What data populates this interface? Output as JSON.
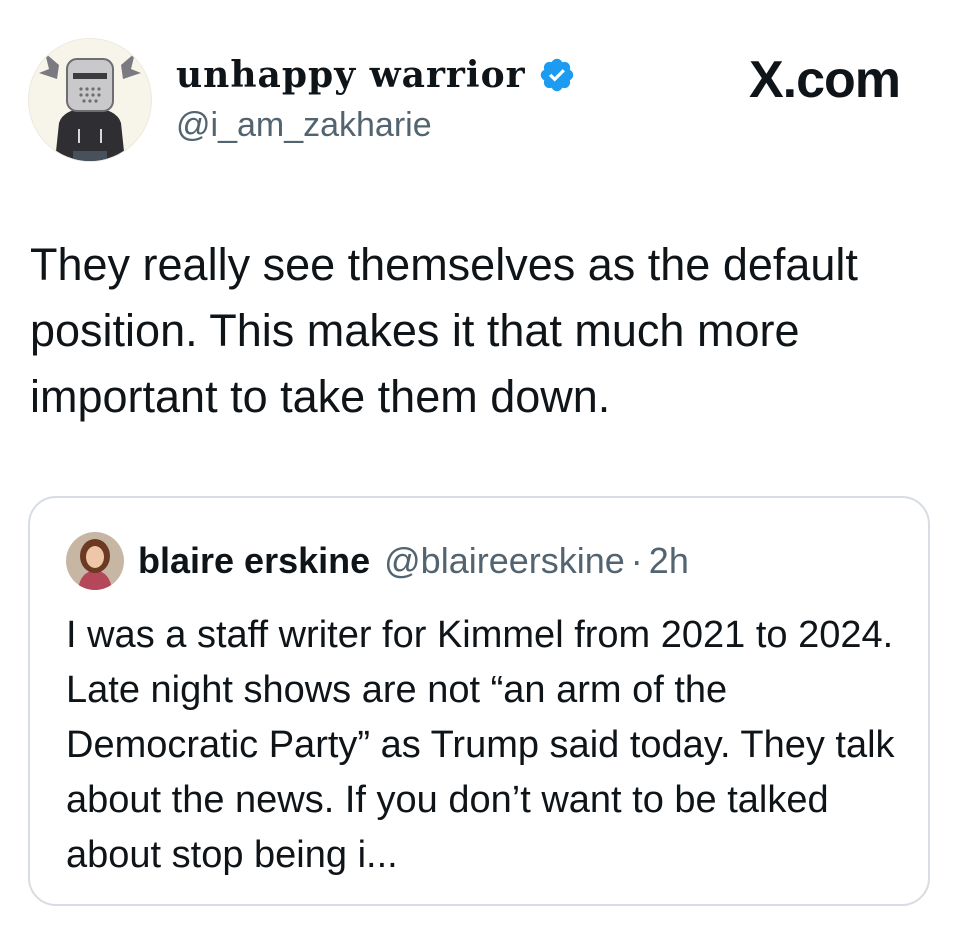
{
  "author": {
    "display_name": "unhappy warrior",
    "handle": "@i_am_zakharie",
    "verified": true,
    "avatar_icon": "knight-helmet-hoodie-avatar",
    "verified_color": "#1d9bf0"
  },
  "site": {
    "logo_text": "X.com"
  },
  "tweet": {
    "text": "They really see themselves as the default position. This makes it that much more important to take them down."
  },
  "quoted_tweet": {
    "display_name": "blaire erskine",
    "handle": "@blaireerskine",
    "separator": "·",
    "time": "2h",
    "avatar_icon": "woman-portrait-avatar",
    "text": "I was a staff writer for Kimmel from 2021 to 2024. Late night shows are not “an arm of the Democratic Party” as Trump said today. They talk about the news. If you don’t want to be talked about stop being i..."
  },
  "colors": {
    "text_primary": "#0f1419",
    "text_secondary": "#536471",
    "border": "#d7dde2"
  }
}
